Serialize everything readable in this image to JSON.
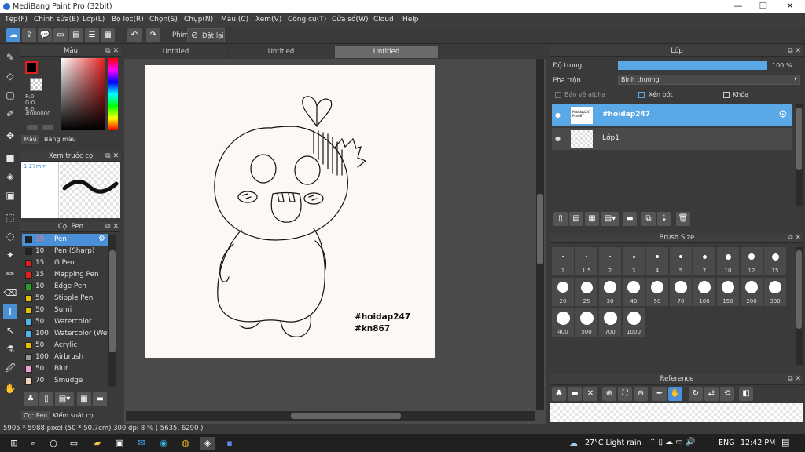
{
  "window": {
    "title": "MediBang Paint Pro (32bit)",
    "minimize": "—",
    "maximize": "❐",
    "close": "✕"
  },
  "menu": [
    "Tệp(F)",
    "Chỉnh sửa(E)",
    "Lớp(L)",
    "Bộ lọc(R)",
    "Chọn(S)",
    "Chụp(N)",
    "Màu (C)",
    "Xem(V)",
    "Công cụ(T)",
    "Cửa sổ(W)",
    "Cloud",
    "Help"
  ],
  "toolbar": {
    "phim_label": "Phím",
    "reset_label": "Đặt lại"
  },
  "color_panel": {
    "title": "Màu",
    "r": "R:0",
    "g": "G:0",
    "b": "B:0",
    "hex": "#000000",
    "tab_color": "Màu",
    "tab_palette": "Bảng màu"
  },
  "brush_preview": {
    "title": "Xem trước cọ",
    "size": "1.27mm"
  },
  "brush_panel": {
    "title": "Cọ: Pen",
    "items": [
      {
        "size": "15",
        "name": "Pen",
        "color": "#222222"
      },
      {
        "size": "10",
        "name": "Pen (Sharp)",
        "color": "#222222"
      },
      {
        "size": "15",
        "name": "G Pen",
        "color": "#e02020"
      },
      {
        "size": "15",
        "name": "Mapping Pen",
        "color": "#e02020"
      },
      {
        "size": "10",
        "name": "Edge Pen",
        "color": "#20a020"
      },
      {
        "size": "50",
        "name": "Stipple Pen",
        "color": "#e8c000"
      },
      {
        "size": "50",
        "name": "Sumi",
        "color": "#e8c000"
      },
      {
        "size": "50",
        "name": "Watercolor",
        "color": "#4ab8e8"
      },
      {
        "size": "100",
        "name": "Watercolor (Wet)",
        "color": "#4ab8e8"
      },
      {
        "size": "50",
        "name": "Acrylic",
        "color": "#e8c000"
      },
      {
        "size": "100",
        "name": "Airbrush",
        "color": "#999999"
      },
      {
        "size": "50",
        "name": "Blur",
        "color": "#f0a0d0"
      },
      {
        "size": "70",
        "name": "Smudge",
        "color": "#f2d2b8"
      }
    ],
    "bottom_tab1": "Cọ: Pen",
    "bottom_tab2": "Kiểm soát cọ"
  },
  "tabs": [
    "Untitled",
    "Untitled",
    "Untitled"
  ],
  "canvas": {
    "text_line1": "#hoidap247",
    "text_line2": "#kn867"
  },
  "layer_panel": {
    "title": "Lớp",
    "opacity_label": "Độ trong",
    "opacity_value": "100 %",
    "opacity_fraction": 1.0,
    "blend_label": "Pha trộn",
    "blend_value": "Bình thường",
    "protect_alpha": "Bảo vệ alpha",
    "clip": "Xén bớt",
    "lock": "Khóa",
    "layers": [
      {
        "name": "#hoidap247",
        "thumb_text": "#hoidap247 #kn867",
        "selected": true
      },
      {
        "name": "Lớp1",
        "selected": false
      }
    ]
  },
  "brush_size_panel": {
    "title": "Brush Size",
    "sizes": [
      "1",
      "1.5",
      "2",
      "3",
      "4",
      "5",
      "7",
      "10",
      "12",
      "15",
      "20",
      "25",
      "30",
      "40",
      "50",
      "70",
      "100",
      "150",
      "200",
      "300",
      "400",
      "500",
      "700",
      "1000"
    ]
  },
  "reference_panel": {
    "title": "Reference"
  },
  "status": {
    "text": "5905 * 5988 pixel  (50 * 50.7cm)  300 dpi  8 %  ( 5635, 6290 )"
  },
  "taskbar": {
    "weather": "27°C  Light rain",
    "lang": "ENG",
    "time": "12:42 PM"
  }
}
